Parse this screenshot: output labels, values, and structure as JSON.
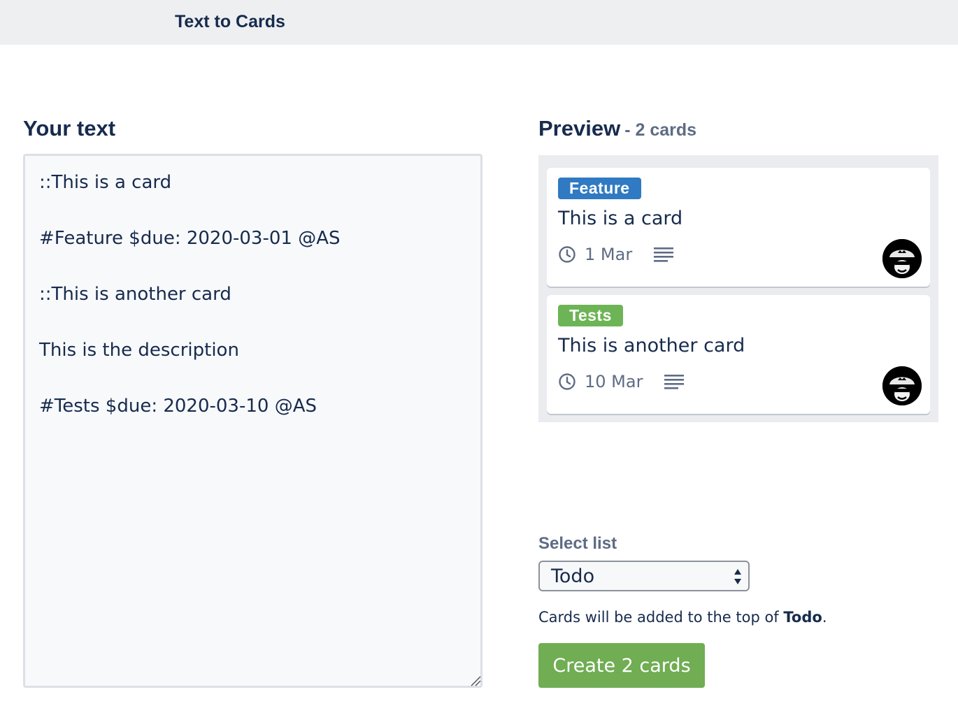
{
  "header": {
    "title": "Text to Cards"
  },
  "input": {
    "heading": "Your text",
    "value": "::This is a card\n\n#Feature $due: 2020-03-01 @AS\n\n::This is another card\n\nThis is the description\n\n#Tests $due: 2020-03-10 @AS"
  },
  "preview": {
    "title": "Preview",
    "count": "- 2 cards",
    "cards": [
      {
        "label": "Feature",
        "label_color": "#2f7ac2",
        "title": "This is a card",
        "due": "1 Mar",
        "icons": [
          "clock-icon",
          "description-icon",
          "avatar"
        ]
      },
      {
        "label": "Tests",
        "label_color": "#6db456",
        "title": "This is another card",
        "due": "10 Mar",
        "icons": [
          "clock-icon",
          "description-icon",
          "avatar"
        ]
      }
    ]
  },
  "list_select": {
    "label": "Select list",
    "selected": "Todo",
    "note_prefix": "Cards will be added to the top of ",
    "note_list": "Todo",
    "note_suffix": "."
  },
  "actions": {
    "create_label": "Create 2 cards",
    "create_color": "#70ad53"
  }
}
